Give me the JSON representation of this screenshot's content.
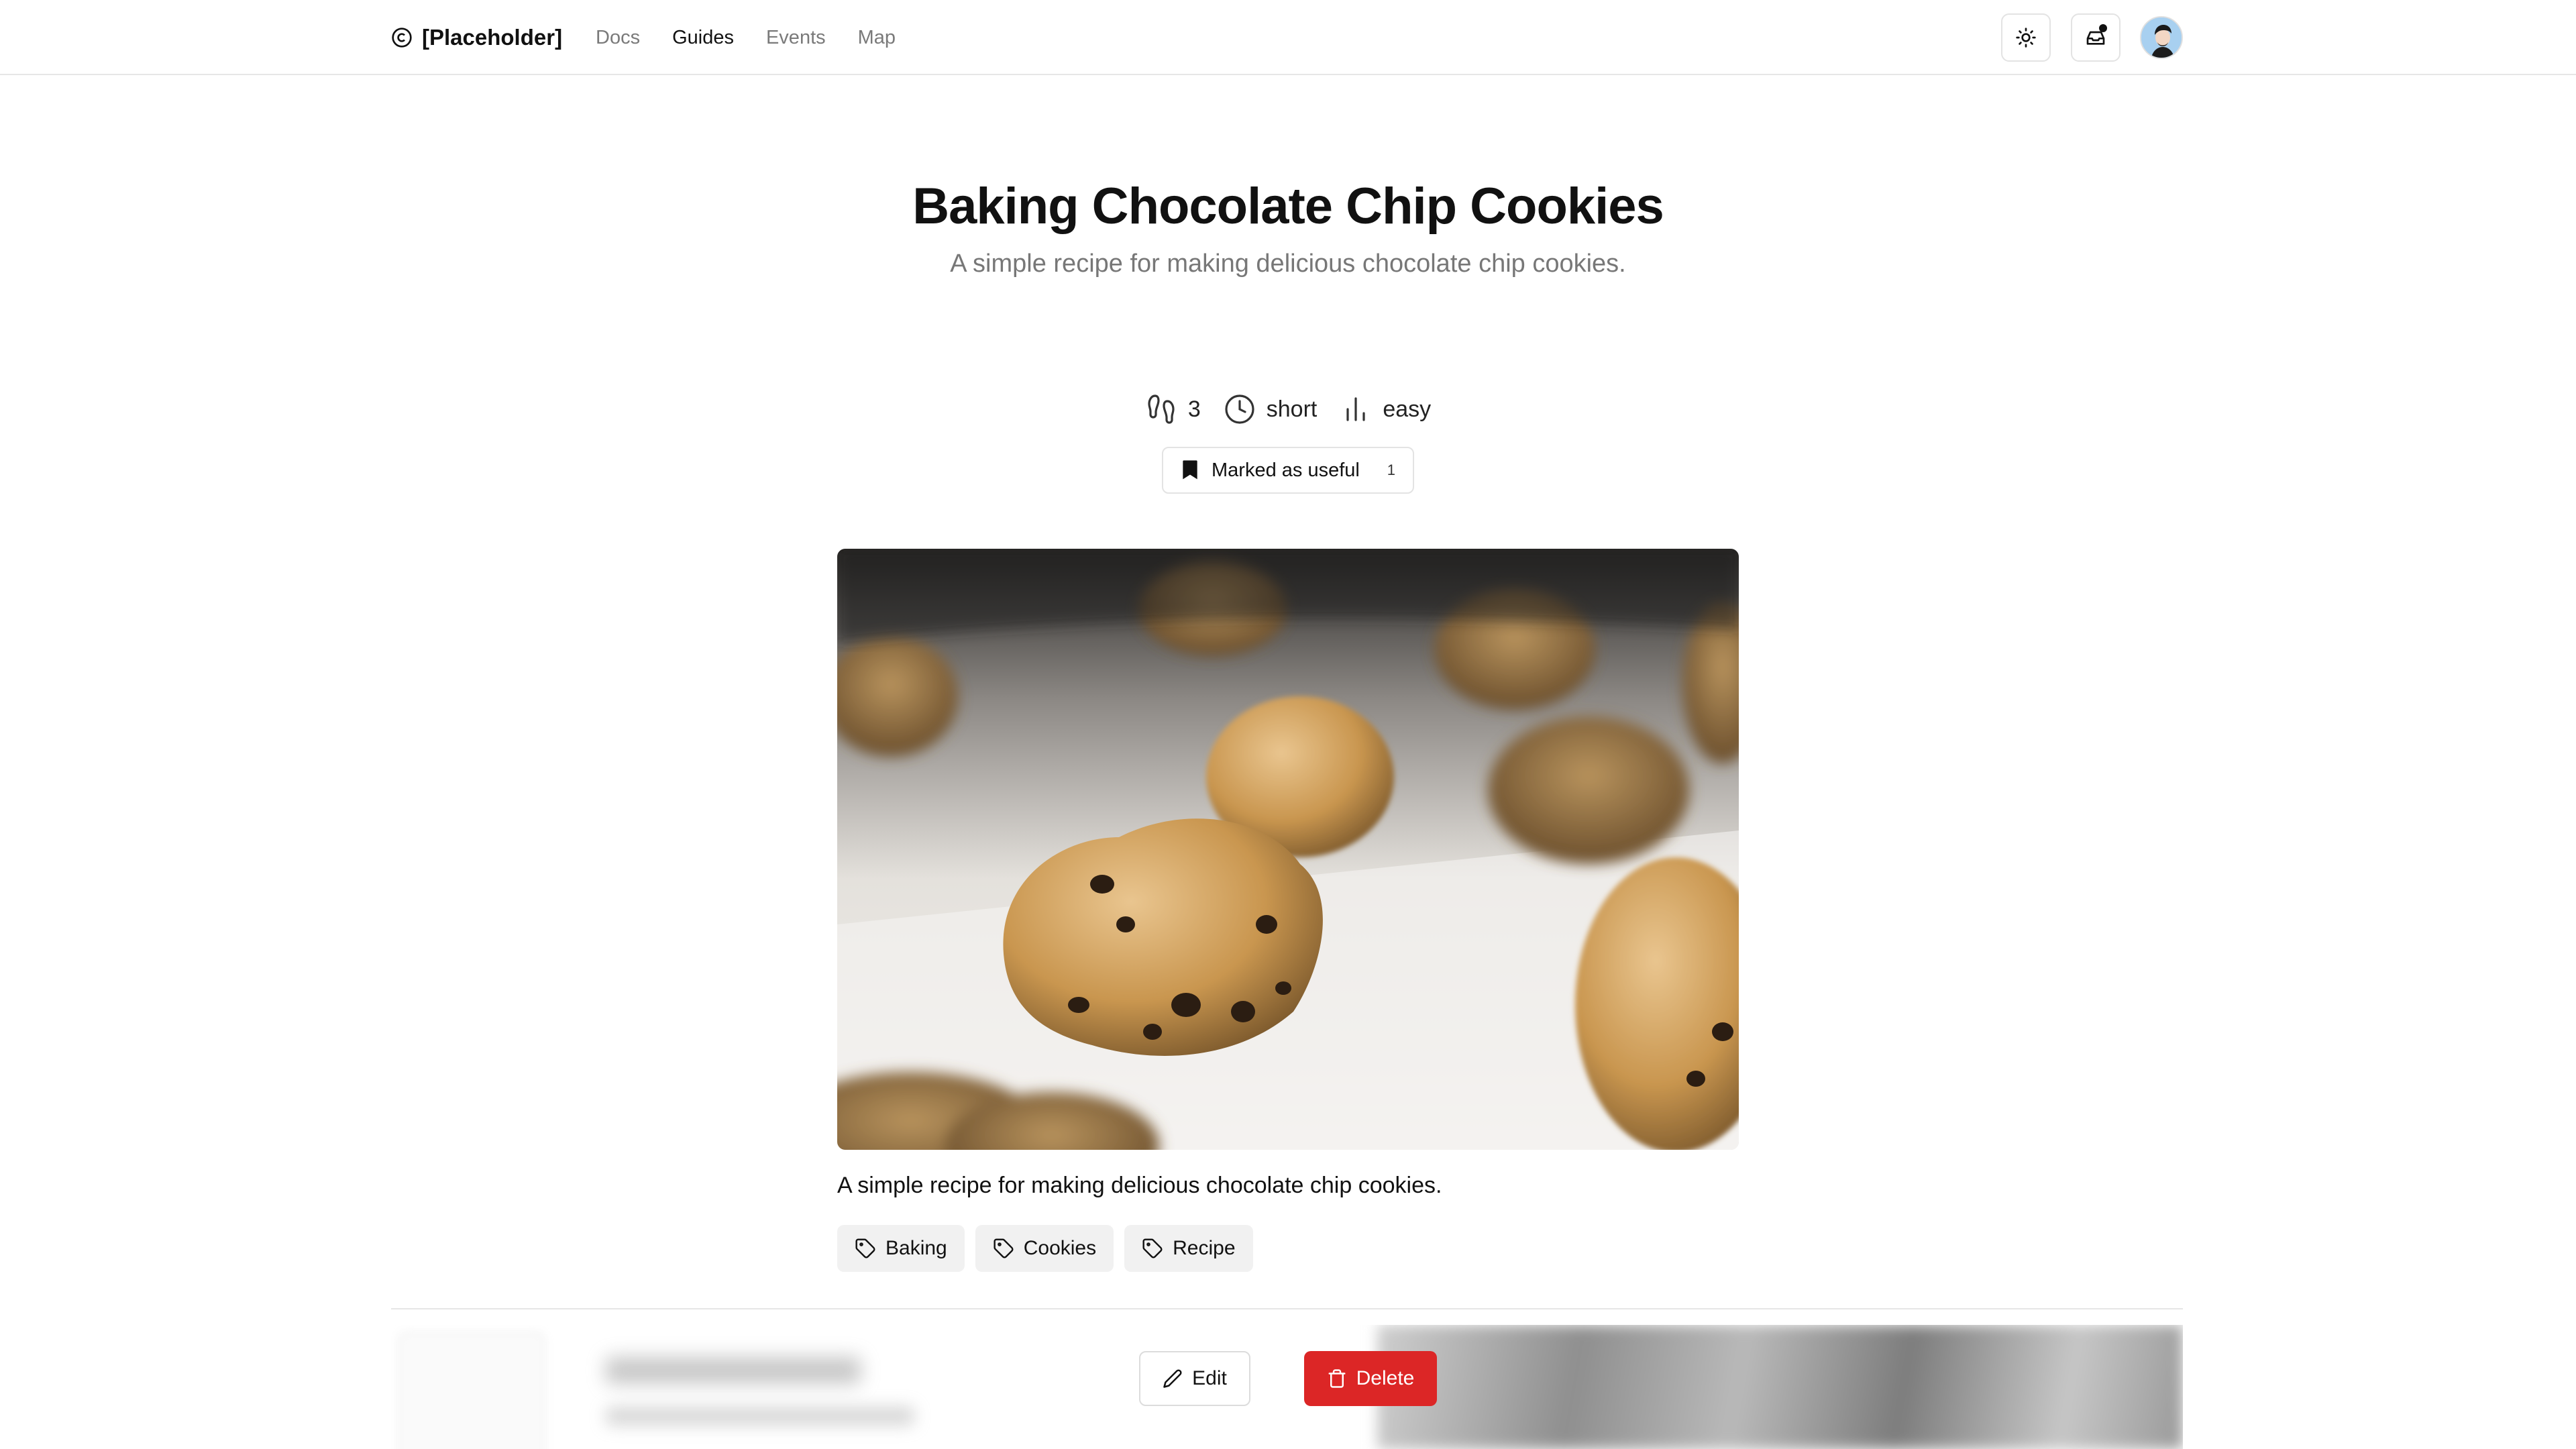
{
  "header": {
    "brand": "[Placeholder]",
    "nav": [
      "Docs",
      "Guides",
      "Events",
      "Map"
    ],
    "active_nav": "Guides"
  },
  "guide": {
    "title": "Baking Chocolate Chip Cookies",
    "subtitle": "A simple recipe for making delicious chocolate chip cookies.",
    "meta": {
      "steps": "3",
      "duration": "short",
      "difficulty": "easy"
    },
    "useful_label": "Marked as useful",
    "useful_count": "1",
    "caption": "A simple recipe for making delicious chocolate chip cookies.",
    "tags": [
      "Baking",
      "Cookies",
      "Recipe"
    ]
  },
  "actions": {
    "edit": "Edit",
    "delete": "Delete"
  },
  "colors": {
    "danger": "#dc2626",
    "text": "#111111",
    "muted": "#777777",
    "tag_bg": "#f1f1f1"
  },
  "icons": {
    "brand": "copyright-icon",
    "theme": "sun-icon",
    "inbox": "inbox-icon",
    "steps": "footprints-icon",
    "duration": "clock-icon",
    "difficulty": "bar-chart-icon",
    "useful": "bookmark-icon",
    "tag": "tag-icon",
    "edit": "pencil-icon",
    "delete": "trash-icon"
  }
}
